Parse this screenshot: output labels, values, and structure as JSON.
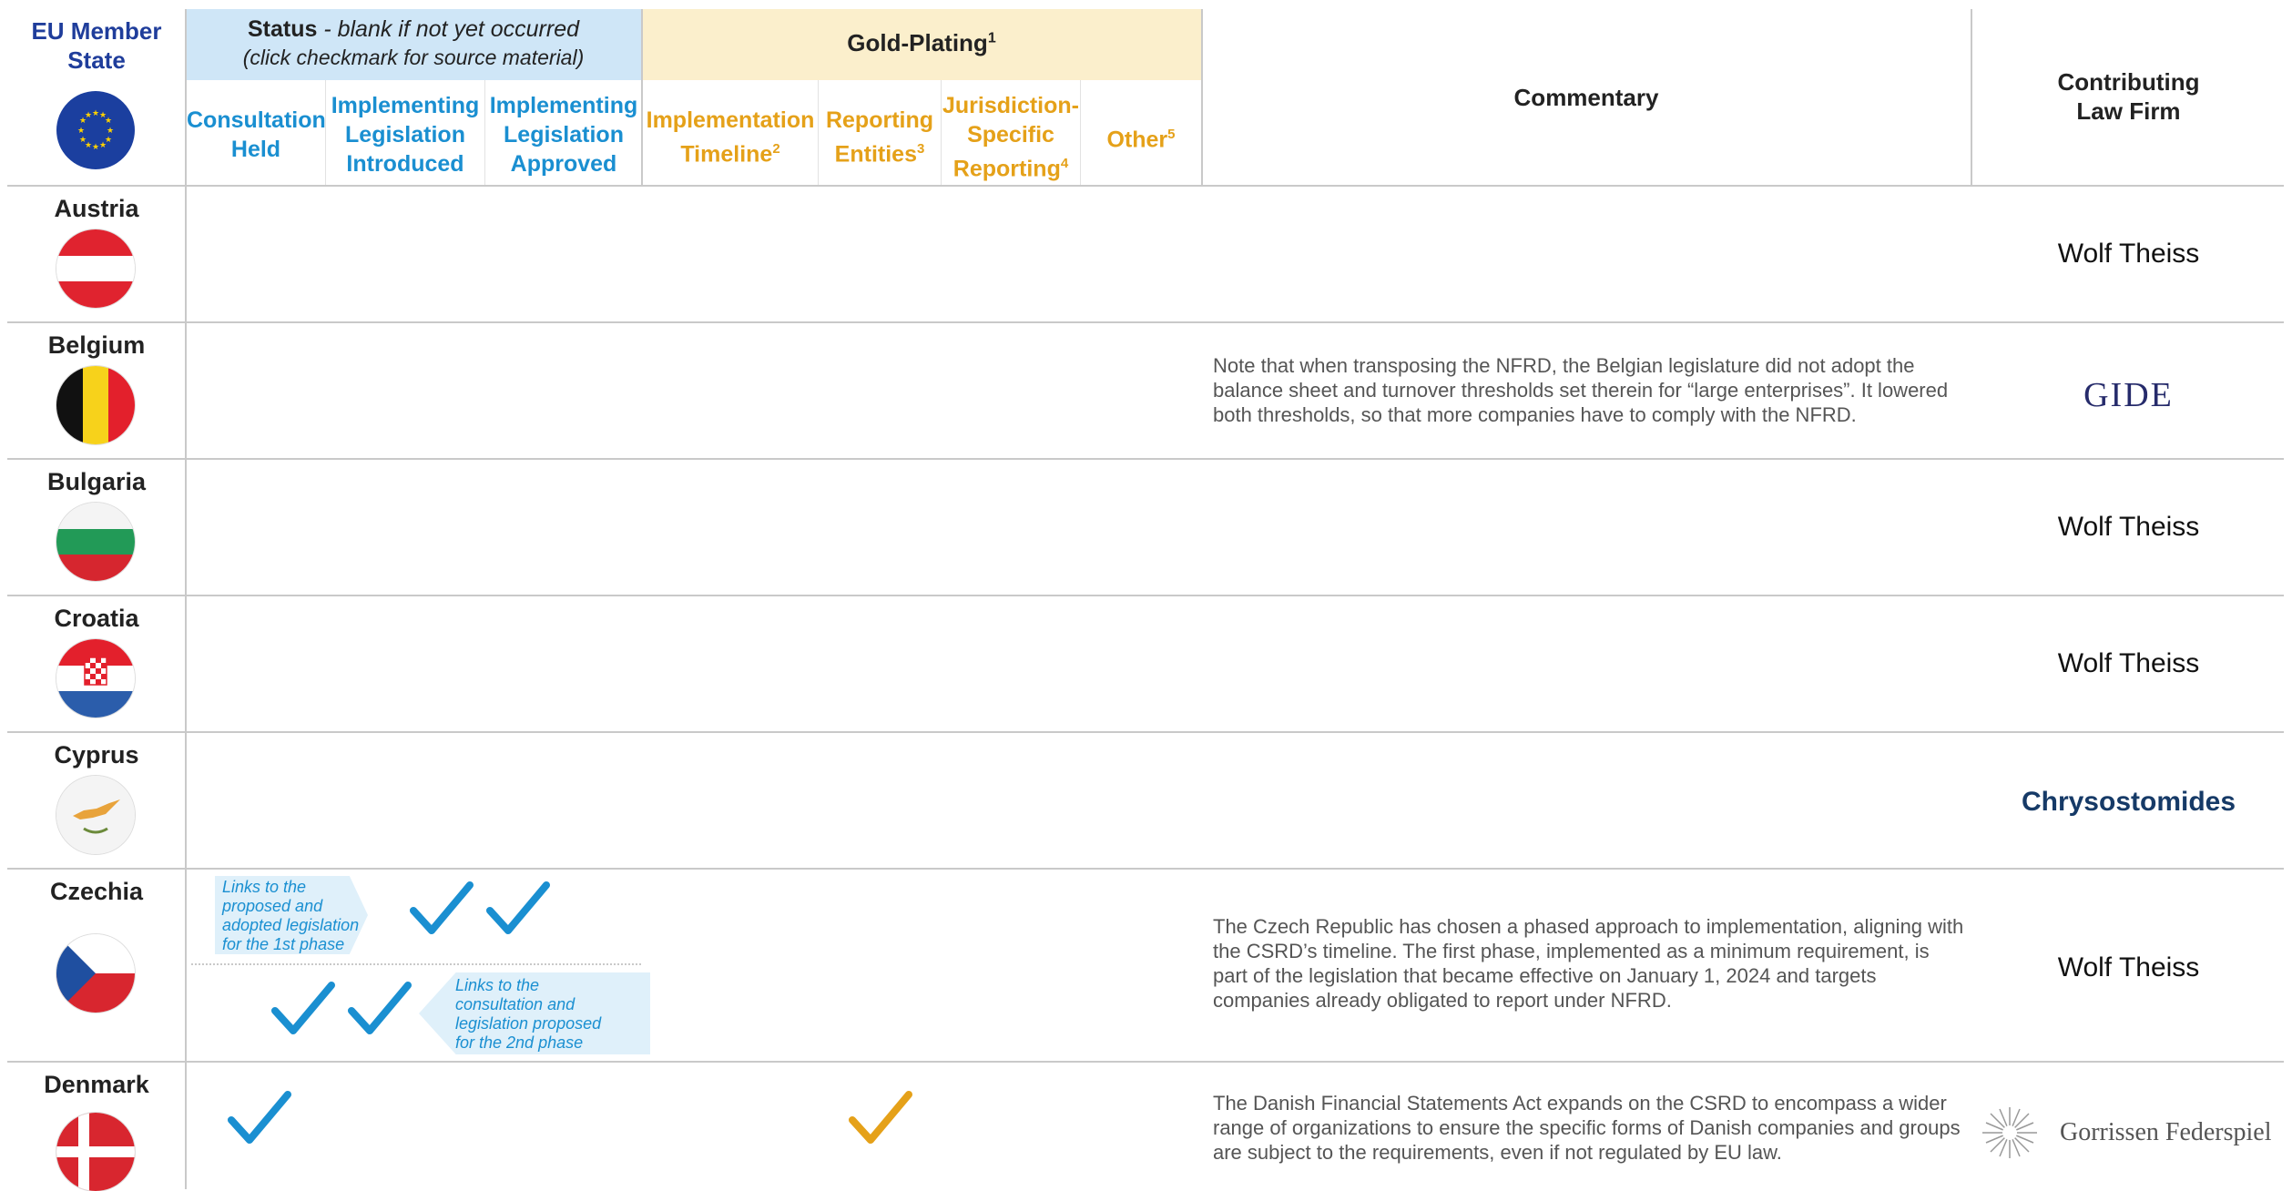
{
  "header": {
    "state_col": [
      "EU Member",
      "State"
    ],
    "status_title": "Status",
    "status_title_rest": " - blank if not yet occurred",
    "status_sub": "(click checkmark for source material)",
    "gold_title": "Gold-Plating",
    "gold_sup": "1",
    "status_cols": [
      {
        "lines": [
          "Consultation",
          "Held"
        ]
      },
      {
        "lines": [
          "Implementing",
          "Legislation",
          "Introduced"
        ]
      },
      {
        "lines": [
          "Implementing",
          "Legislation",
          "Approved"
        ]
      }
    ],
    "gold_cols": [
      {
        "lines": [
          "Implementation",
          "Timeline"
        ],
        "sup": "2"
      },
      {
        "lines": [
          "Reporting",
          "Entities"
        ],
        "sup": "3"
      },
      {
        "lines": [
          "Jurisdiction-",
          "Specific",
          "Reporting"
        ],
        "sup": "4"
      },
      {
        "lines": [
          "Other"
        ],
        "sup": "5"
      }
    ],
    "commentary": "Commentary",
    "law_firm": [
      "Contributing",
      "Law Firm"
    ]
  },
  "rows": [
    {
      "country": "Austria",
      "law_firm": "Wolf Theiss",
      "commentary": ""
    },
    {
      "country": "Belgium",
      "law_firm": "GIDE",
      "commentary": "Note that when transposing the NFRD, the Belgian legislature did not adopt the balance sheet and turnover thresholds set therein for “large enterprises”. It lowered both thresholds, so that more companies have to comply with the NFRD."
    },
    {
      "country": "Bulgaria",
      "law_firm": "Wolf Theiss",
      "commentary": ""
    },
    {
      "country": "Croatia",
      "law_firm": "Wolf Theiss",
      "commentary": ""
    },
    {
      "country": "Cyprus",
      "law_firm": "Chrysostomides",
      "commentary": ""
    },
    {
      "country": "Czechia",
      "law_firm": "Wolf Theiss",
      "commentary": "The Czech Republic has chosen a phased approach to implementation, aligning with the CSRD’s timeline. The first phase, implemented as a minimum requirement, is part of the legislation that became effective on January 1, 2024 and targets companies already obligated to report under NFRD.",
      "callout_1": [
        "Links to the",
        "proposed and",
        "adopted legislation",
        "for the 1st phase"
      ],
      "callout_2": [
        "Links to the",
        "consultation and",
        "legislation proposed",
        "for the 2nd phase"
      ]
    },
    {
      "country": "Denmark",
      "law_firm": "Gorrissen Federspiel",
      "commentary": "The Danish Financial Statements Act expands on the CSRD to encompass a wider range of organizations to ensure the specific forms of Danish companies and groups are subject to the requirements, even if not regulated by EU law."
    }
  ],
  "colors": {
    "status_blue": "#1a8fd1",
    "gold_orange": "#e5a119",
    "state_blue": "#1f3d9b"
  }
}
